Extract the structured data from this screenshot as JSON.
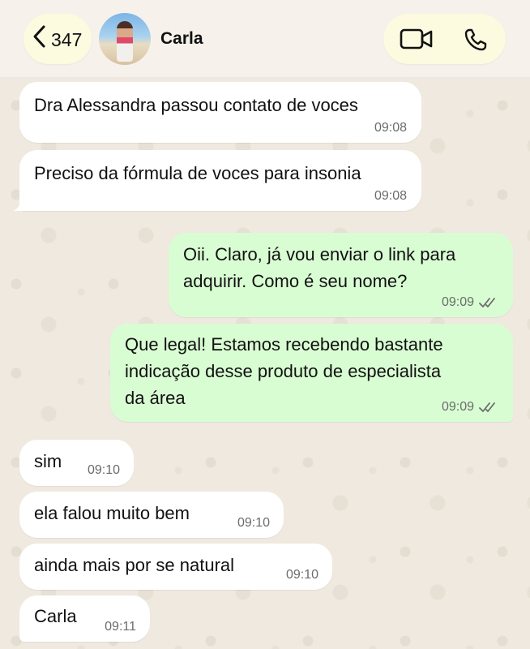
{
  "header": {
    "back_count": "347",
    "contact_name": "Carla",
    "icons": [
      "chevron-left-icon",
      "video-camera-icon",
      "phone-icon"
    ]
  },
  "messages": [
    {
      "dir": "in",
      "text": "Dra Alessandra passou contato de voces",
      "time": "09:08"
    },
    {
      "dir": "in",
      "text": "Preciso da fórmula de voces para insonia",
      "time": "09:08"
    },
    {
      "dir": "out",
      "text": "Oii. Claro, já vou enviar o link para\nadquirir. Como é seu nome?",
      "time": "09:09",
      "status": "read"
    },
    {
      "dir": "out",
      "text": "Que legal! Estamos recebendo bastante\nindicação desse produto de especialista\nda área",
      "time": "09:09",
      "status": "read"
    },
    {
      "dir": "in",
      "text": "sim",
      "time": "09:10"
    },
    {
      "dir": "in",
      "text": "ela falou muito bem",
      "time": "09:10"
    },
    {
      "dir": "in",
      "text": "ainda mais por se natural",
      "time": "09:10"
    },
    {
      "dir": "in",
      "text": "Carla",
      "time": "09:11"
    }
  ],
  "colors": {
    "incoming_bubble": "#ffffff",
    "outgoing_bubble": "#d9fdd3",
    "header_pill": "#fcfadf",
    "wallpaper": "#efe9df"
  }
}
